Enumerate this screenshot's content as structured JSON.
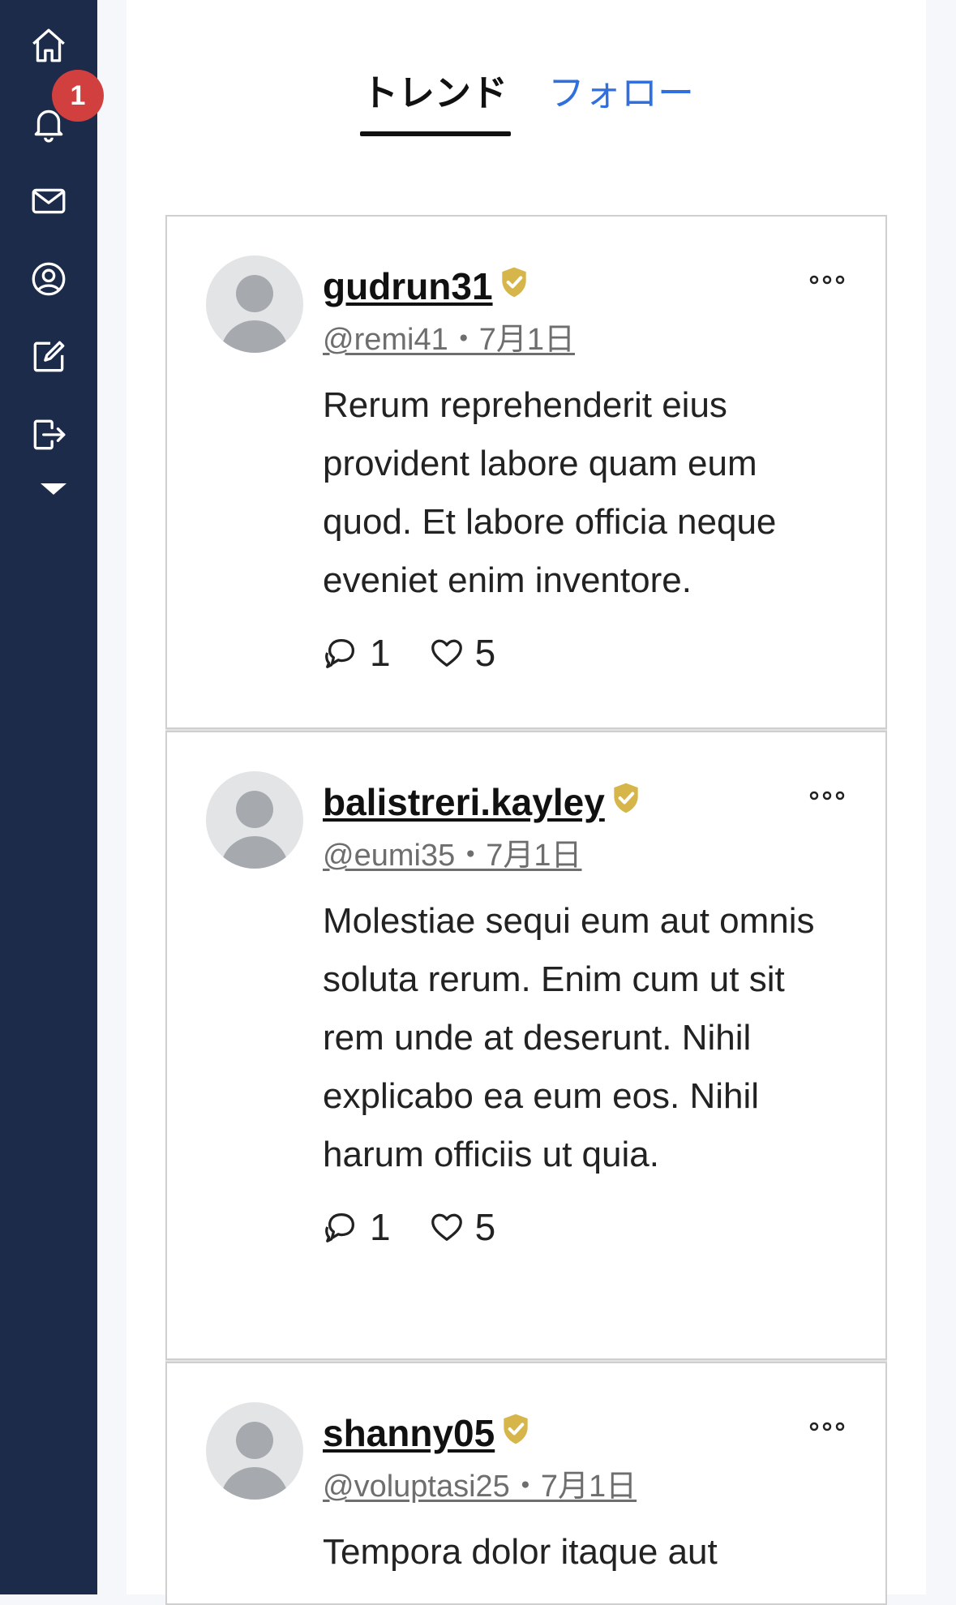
{
  "sidebar": {
    "items": [
      {
        "icon": "home-icon"
      },
      {
        "icon": "bell-icon"
      },
      {
        "icon": "mail-icon"
      },
      {
        "icon": "user-circle-icon"
      },
      {
        "icon": "compose-icon"
      },
      {
        "icon": "logout-icon"
      }
    ],
    "notification_badge": "1",
    "background": "#1c2b4a"
  },
  "tabs": [
    {
      "label": "トレンド",
      "active": true
    },
    {
      "label": "フォロー",
      "active": false
    }
  ],
  "colors": {
    "accent": "#2f6fdf",
    "verified": "#d6b64a",
    "badge": "#d23f3f"
  },
  "posts": [
    {
      "username": "gudrun31",
      "meta": "@remi41・7月1日",
      "text": "Rerum reprehenderit eius provident labore quam eum quod. Et labore officia neque eveniet enim inventore.",
      "replies": "1",
      "likes": "5"
    },
    {
      "username": "balistreri.kayley",
      "meta": "@eumi35・7月1日",
      "text": "Molestiae sequi eum aut omnis soluta rerum. Enim cum ut sit rem unde at deserunt. Nihil explicabo ea eum eos. Nihil harum officiis ut quia.",
      "replies": "1",
      "likes": "5"
    },
    {
      "username": "shanny05",
      "meta": "@voluptasi25・7月1日",
      "text": "Tempora dolor itaque aut",
      "replies": "",
      "likes": ""
    }
  ]
}
